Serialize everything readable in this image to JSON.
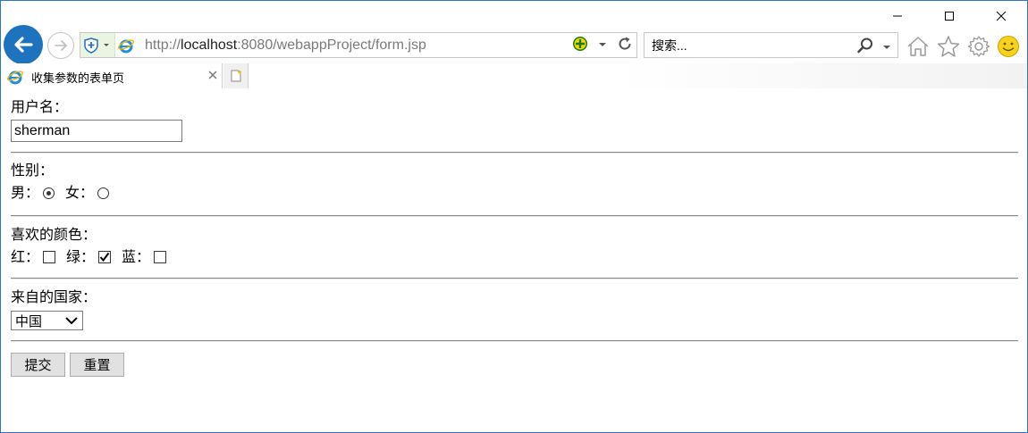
{
  "window": {
    "caption_buttons": [
      "minimize",
      "maximize",
      "close"
    ]
  },
  "address_bar": {
    "url_prefix": "http://",
    "url_host": "localhost",
    "url_rest": ":8080/webappProject/form.jsp"
  },
  "search_bar": {
    "placeholder": "搜索..."
  },
  "tab": {
    "title": "收集参数的表单页"
  },
  "form": {
    "username_label": "用户名：",
    "username_value": "sherman",
    "gender_label": "性别：",
    "gender_options": [
      {
        "label": "男：",
        "checked": true
      },
      {
        "label": "女：",
        "checked": false
      }
    ],
    "color_label": "喜欢的颜色：",
    "color_options": [
      {
        "label": "红：",
        "checked": false
      },
      {
        "label": "绿：",
        "checked": true
      },
      {
        "label": "蓝：",
        "checked": false
      }
    ],
    "country_label": "来自的国家：",
    "country_selected": "中国",
    "submit_label": "提交",
    "reset_label": "重置"
  },
  "icons": {
    "accent": "#1e73be"
  }
}
